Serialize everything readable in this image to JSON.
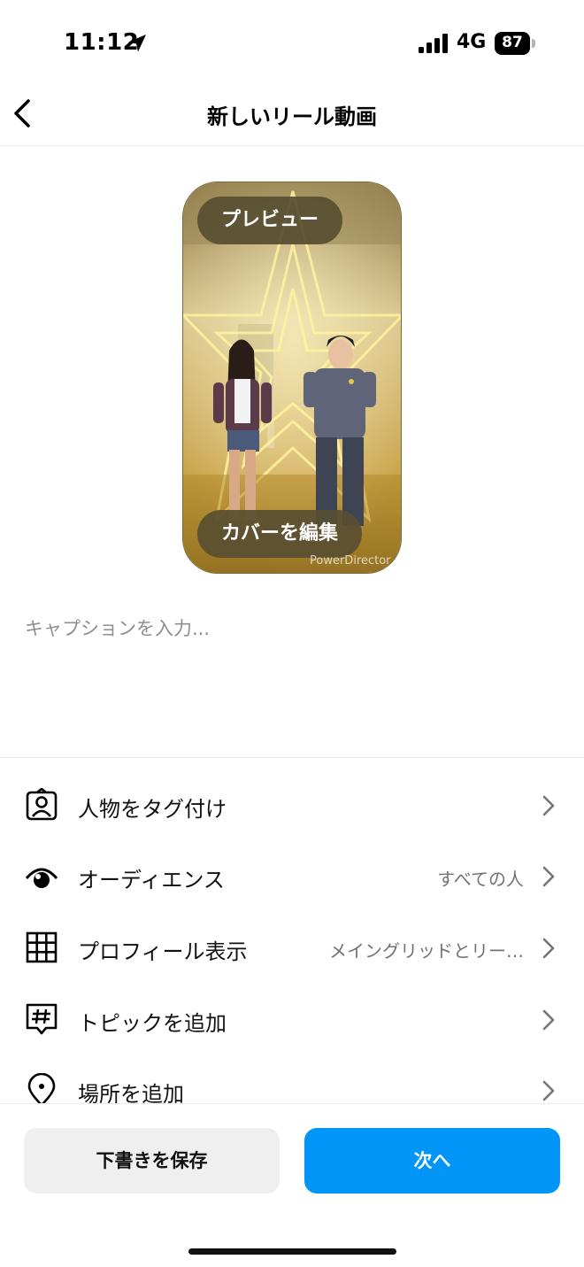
{
  "status_bar": {
    "time": "11:12",
    "network": "4G",
    "battery_level": "87",
    "icons": [
      "location-arrow-icon",
      "signal-icon",
      "battery-icon"
    ]
  },
  "header": {
    "title": "新しいリール動画",
    "back_icon": "chevron-left-icon"
  },
  "preview": {
    "preview_label": "プレビュー",
    "edit_cover_label": "カバーを編集",
    "watermark": "PowerDirector"
  },
  "caption": {
    "placeholder": "キャプションを入力..."
  },
  "settings": [
    {
      "icon": "tag-person-icon",
      "label": "人物をタグ付け",
      "value": ""
    },
    {
      "icon": "eye-icon",
      "label": "オーディエンス",
      "value": "すべての人"
    },
    {
      "icon": "grid-icon",
      "label": "プロフィール表示",
      "value": "メイングリッドとリー…"
    },
    {
      "icon": "hashtag-icon",
      "label": "トピックを追加",
      "value": ""
    },
    {
      "icon": "location-pin-icon",
      "label": "場所を追加",
      "value": ""
    }
  ],
  "footer": {
    "save_draft_label": "下書きを保存",
    "next_label": "次へ"
  },
  "colors": {
    "accent": "#0095f6",
    "pill_background": "#584e32",
    "secondary_text": "#737373"
  }
}
